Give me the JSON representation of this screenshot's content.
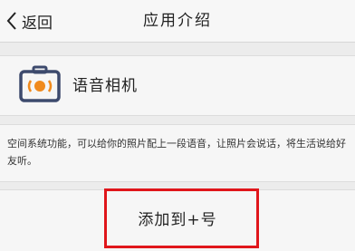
{
  "nav": {
    "back_label": "返回",
    "back_icon": "chevron-left-icon",
    "title": "应用介绍"
  },
  "app": {
    "icon": "camera-icon",
    "name": "语音相机"
  },
  "description": "空间系统功能，可以给你的照片配上一段语音，让照片会说话，将生活说给好友听。",
  "action": {
    "add_label": "添加到+号"
  },
  "colors": {
    "highlight": "#e0161b",
    "camera_body": "#3d4a6d",
    "camera_ring": "#f08a1d"
  }
}
